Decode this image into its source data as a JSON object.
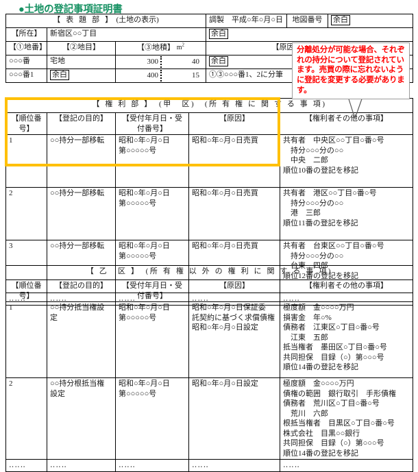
{
  "document": {
    "title": "●土地の登記事項証明書",
    "title_color": "#169162",
    "highlight_color": "#FFC000",
    "callout_color": "#FF0000"
  },
  "callout": {
    "text": "分離処分が可能な場合、それぞれの持分について登記されています。売買の際に忘れないように登記を変更する必要があります。"
  },
  "hyodaibu": {
    "section_title": "【 表 題 部 】",
    "section_note": "(土地の表示)",
    "chosei_label": "調製　平成○年○月○日",
    "chizu_label": "地図番号",
    "chizu_value": "余白",
    "shozai_label": "【所在】",
    "shozai_value": "新宿区○○丁目",
    "shozai_right": "余白",
    "col_chiban": "【①地番】",
    "col_chimoku": "【②地目】",
    "col_chiseki": "【③地積】",
    "chiseki_unit": "m2",
    "col_gen_in": "【原因及びその日付】",
    "rows": [
      {
        "chiban": "○○○番",
        "chimoku": "宅地",
        "chimoku_boxed": false,
        "area_whole": "300",
        "area_frac": "40",
        "gen_in": "余白",
        "gen_in_boxed": true
      },
      {
        "chiban": "○○○番1",
        "chimoku": "余白",
        "chimoku_boxed": true,
        "area_whole": "400",
        "area_frac": "15",
        "gen_in": "①③○○○番1、2に分筆",
        "gen_in_boxed": false
      }
    ]
  },
  "kouku": {
    "section_title": "【 権 利 部 】　(甲　区)　(所 有 権 に 関 す る 事 項)",
    "headers": {
      "junni": "【順位番号】",
      "mokuteki": "【登記の目的】",
      "uketsuke": "【受付年月日・受付番号】",
      "genin": "【原因】",
      "kenrisha": "【権利者その他の事項】"
    },
    "rows": [
      {
        "junni": "1",
        "mokuteki": "○○持分一部移転",
        "uketsuke_1": "昭和○年○月○日",
        "uketsuke_2": "第○○○○○号",
        "genin": "昭和○年○月○日売買",
        "kenrisha_1": "共有者　中央区○○丁目○番○号",
        "kenrisha_2": "　持分○○○分の○○",
        "kenrisha_3": "　中央　二郎",
        "kenrisha_4": "順位10番の登記を移記"
      },
      {
        "junni": "2",
        "mokuteki": "○○持分一部移転",
        "uketsuke_1": "昭和○年○月○日",
        "uketsuke_2": "第○○○○○号",
        "genin": "昭和○年○月○日売買",
        "kenrisha_1": "共有者　港区○○丁目○番○号",
        "kenrisha_2": "　持分○○○分の○○",
        "kenrisha_3": "　港　三郎",
        "kenrisha_4": "順位11番の登記を移記"
      },
      {
        "junni": "3",
        "mokuteki": "○○持分一部移転",
        "uketsuke_1": "昭和○年○月○日",
        "uketsuke_2": "第○○○○○号",
        "genin": "昭和○年○月○日売買",
        "kenrisha_1": "共有者　台東区○○丁目○番○号",
        "kenrisha_2": "　持分○○○分の○○",
        "kenrisha_3": "　台東　四郎",
        "kenrisha_4": "順位12番の登記を移記"
      }
    ],
    "dots": "‥‥‥"
  },
  "otsuku": {
    "section_title": "【 乙　区 】　(所 有 権 以 外 の 権 利 に 関 す る 事 項)",
    "headers": {
      "junni": "【順位番号】",
      "mokuteki": "【登記の目的】",
      "uketsuke": "【受付年月日・受付番号】",
      "genin": "【原因】",
      "kenrisha": "【権利者その他の事項】"
    },
    "rows": [
      {
        "junni": "1",
        "mokuteki_1": "○○持分抵当権設",
        "mokuteki_2": "定",
        "uketsuke_1": "昭和○年○月○日",
        "uketsuke_2": "第○○○○○号",
        "genin_1": "昭和○年○月○日保証委",
        "genin_2": "託契約に基づく求償債権",
        "genin_3": "昭和○年○月○日設定",
        "kenrisha_1": "極度額　金○○○○万円",
        "kenrisha_2": "損害金　年○%",
        "kenrisha_3": "債務者　江東区○丁目○番○号",
        "kenrisha_4": "　江東　五郎",
        "kenrisha_5": "抵当権者　墨田区○丁目○番○号",
        "kenrisha_6": "共同担保　目録（○）第○○○号",
        "kenrisha_7": "順位14番の登記を移記"
      },
      {
        "junni": "2",
        "mokuteki_1": "○○持分根抵当権",
        "mokuteki_2": "設定",
        "uketsuke_1": "昭和○年○月○日",
        "uketsuke_2": "第○○○○○号",
        "genin_1": "昭和○年○月○日設定",
        "genin_2": "",
        "genin_3": "",
        "kenrisha_1": "極度額　金○○○○万円",
        "kenrisha_2": "債権の範囲　銀行取引　手形債権",
        "kenrisha_3": "債務者　荒川区○丁目○番○号",
        "kenrisha_4": "　荒川　六郎",
        "kenrisha_5": "根抵当権者　目黒区○丁目○番○号",
        "kenrisha_6": "株式会社　目黒○○銀行",
        "kenrisha_7": "共同担保　目録（○）第○○○号",
        "kenrisha_8": "順位14番の登記を移記"
      }
    ],
    "dots": "‥‥‥"
  }
}
